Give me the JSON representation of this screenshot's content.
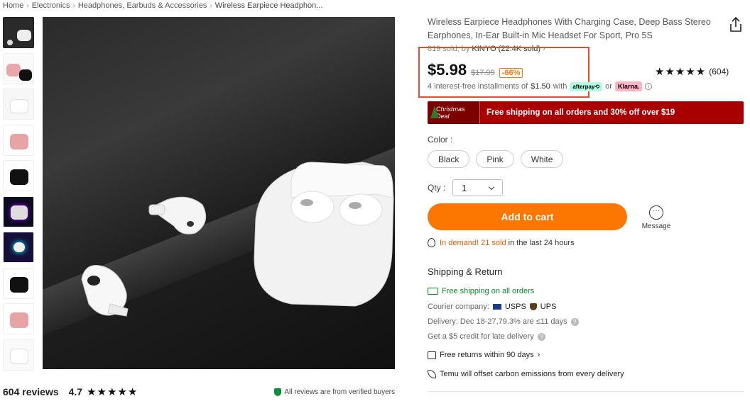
{
  "breadcrumb": {
    "items": [
      "Home",
      "Electronics",
      "Headphones, Earbuds & Accessories",
      "Wireless Earpiece Headphon..."
    ]
  },
  "gallery": {
    "thumbnail_count": 10,
    "thumbnails": [
      "white-case-dark",
      "pink-black",
      "white",
      "pink",
      "black",
      "rgb-box",
      "neon",
      "black-2",
      "pink-2",
      "white-2"
    ]
  },
  "reviews_bar": {
    "count_text": "604 reviews",
    "rating_text": "4.7",
    "stars": "★★★★★",
    "verified_text": "All reviews are from verified buyers"
  },
  "product": {
    "title": "Wireless Earpiece Headphones With Charging Case, Deep Bass Stereo Earphones, In-Ear Built-in Mic Headset For Sport, Pro 5S",
    "sold_text": "819 sold, by",
    "store_text": "KINYO (22.4K sold)",
    "store_chevron": "›",
    "price": "$5.98",
    "original_price": "$17.99",
    "discount": "-66%",
    "installments_prefix": "4 interest-free installments of",
    "installment_amount": "$1.50",
    "installments_with": "with",
    "afterpay_label": "afterpay⟲",
    "or_text": "or",
    "klarna_label": "Klarna.",
    "rating_stars": "★★★★★",
    "rating_count": "(604)"
  },
  "promo": {
    "deal_label": "Christmas Deal",
    "text": "Free shipping on all orders and 30% off over $19"
  },
  "color": {
    "label": "Color :",
    "options": [
      "Black",
      "Pink",
      "White"
    ]
  },
  "qty": {
    "label": "Qty :",
    "value": "1"
  },
  "actions": {
    "add_to_cart": "Add to cart",
    "message": "Message"
  },
  "demand": {
    "hot_text": "In demand! 21 sold",
    "rest_text": "in the last 24 hours"
  },
  "shipping": {
    "heading": "Shipping & Return",
    "free_shipping": "Free shipping on all orders",
    "courier_label": "Courier company:",
    "courier_usps": "USPS",
    "courier_ups": "UPS",
    "delivery": "Delivery: Dec 18-27,79.3% are ≤11 days",
    "late_credit": "Get a $5 credit for late delivery",
    "free_returns": "Free returns within 90 days",
    "free_returns_chevron": "›",
    "carbon": "Temu will offset carbon emissions from every delivery"
  },
  "colors": {
    "accent_orange": "#fb7701",
    "promo_red": "#a80000",
    "highlight_box": "#e74c2e",
    "green": "#0a8a2a"
  }
}
